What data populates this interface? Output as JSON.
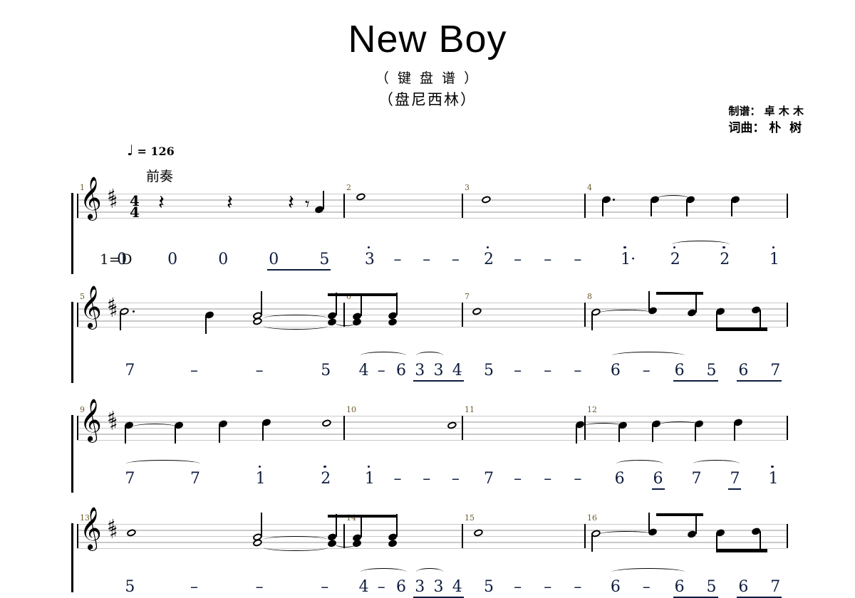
{
  "header": {
    "title": "New Boy",
    "subtitle_1": "（ 键 盘 谱 ）",
    "subtitle_2": "（盘尼西林）",
    "credit_arranger": "制谱： 卓 木 木",
    "credit_composer": "词曲： 朴  树"
  },
  "performance": {
    "tempo_note_glyph": "♩",
    "tempo_text": "= 126",
    "section_label": "前奏",
    "key_signature_label": "1=D",
    "time_signature_top": "4",
    "time_signature_bottom": "4",
    "clef_glyph": "𝄞",
    "sharp_glyph": "♯",
    "quarter_rest_glyph": "𝄽",
    "eighth_rest_glyph": "𝄾",
    "dash_glyph": "–"
  },
  "systems": [
    {
      "index": 1,
      "measures": [
        {
          "number": "1",
          "jianpu": [
            "0",
            "0",
            "0",
            "0",
            "5"
          ]
        },
        {
          "number": "2",
          "jianpu": [
            "3",
            "–",
            "–",
            "–"
          ]
        },
        {
          "number": "3",
          "jianpu": [
            "2",
            "–",
            "–",
            "–"
          ]
        },
        {
          "number": "4",
          "jianpu": [
            "1·",
            "2",
            "2",
            "1"
          ]
        }
      ]
    },
    {
      "index": 2,
      "measures": [
        {
          "number": "5",
          "jianpu": [
            "7",
            "–",
            "–",
            "5"
          ]
        },
        {
          "number": "6",
          "jianpu": [
            "4",
            "–",
            "6",
            "3",
            "3",
            "4"
          ]
        },
        {
          "number": "7",
          "jianpu": [
            "5",
            "–",
            "–",
            "–"
          ]
        },
        {
          "number": "8",
          "jianpu": [
            "6",
            "–",
            "6",
            "5",
            "6",
            "7"
          ]
        }
      ]
    },
    {
      "index": 3,
      "measures": [
        {
          "number": "9",
          "jianpu": [
            "7",
            "7",
            "1",
            "2"
          ]
        },
        {
          "number": "10",
          "jianpu": [
            "1",
            "–",
            "–",
            "–"
          ]
        },
        {
          "number": "11",
          "jianpu": [
            "7",
            "–",
            "–",
            "–"
          ]
        },
        {
          "number": "12",
          "jianpu": [
            "6",
            "6",
            "7",
            "7",
            "1"
          ]
        }
      ]
    },
    {
      "index": 4,
      "measures": [
        {
          "number": "13",
          "jianpu": [
            "5",
            "–",
            "–",
            "–"
          ]
        },
        {
          "number": "14",
          "jianpu": [
            "4",
            "–",
            "6",
            "3",
            "3",
            "4"
          ]
        },
        {
          "number": "15",
          "jianpu": [
            "5",
            "–",
            "–",
            "–"
          ]
        },
        {
          "number": "16",
          "jianpu": [
            "6",
            "–",
            "6",
            "5",
            "6",
            "7"
          ]
        }
      ]
    }
  ],
  "colors": {
    "staff_line": "#c9c9c9",
    "ink": "#000000",
    "jianpu_ink": "#0d1b3e",
    "measure_number": "#6b5a2e"
  }
}
